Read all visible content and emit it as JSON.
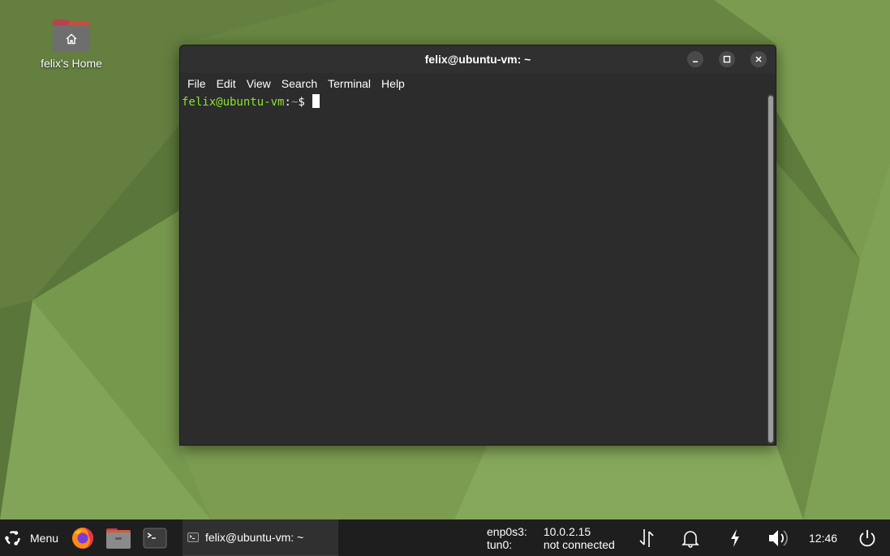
{
  "desktop": {
    "home_icon_label": "felix's Home"
  },
  "window": {
    "title": "felix@ubuntu-vm: ~",
    "menu": [
      "File",
      "Edit",
      "View",
      "Search",
      "Terminal",
      "Help"
    ],
    "prompt": {
      "user_host": "felix@ubuntu-vm",
      "colon": ":",
      "path": "~",
      "dollar": "$"
    }
  },
  "taskbar": {
    "menu_label": "Menu",
    "task_label": "felix@ubuntu-vm: ~",
    "network": {
      "iface1": "enp0s3:",
      "iface1_value": "10.0.2.15",
      "iface2": "tun0:",
      "iface2_value": "not connected"
    },
    "clock": "12:46"
  },
  "icons": {
    "menu": "ubuntu-logo-icon",
    "firefox": "firefox-icon",
    "files": "files-icon",
    "terminal": "terminal-icon",
    "transfer": "network-transfer-icon",
    "bell": "bell-icon",
    "bolt": "power-bolt-icon",
    "volume": "volume-icon",
    "power": "power-icon"
  },
  "colors": {
    "wallpaper": "#6b8a45",
    "terminal_bg": "#2c2c2c",
    "prompt_user": "#8ae234",
    "prompt_path": "#729fcf",
    "taskbar": "#1e1e1e"
  }
}
